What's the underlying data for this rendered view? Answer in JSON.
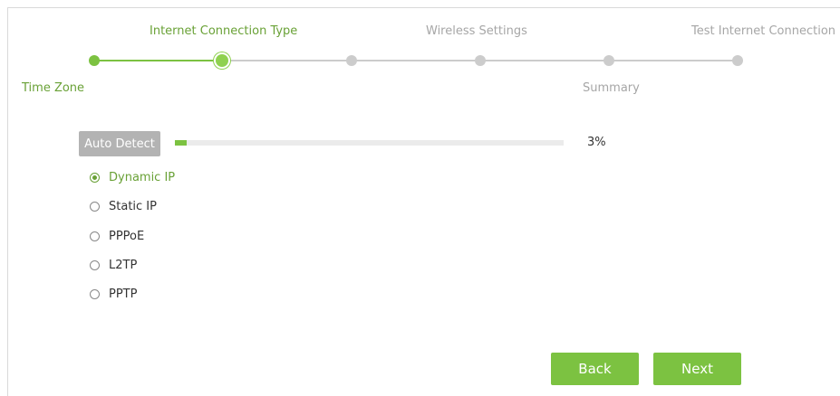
{
  "steps": {
    "internet_connection_type": "Internet Connection Type",
    "wireless_settings": "Wireless Settings",
    "test_internet_connection": "Test Internet Connection",
    "time_zone": "Time Zone",
    "summary": "Summary"
  },
  "auto_detect": {
    "button_label": "Auto Detect",
    "progress_percent": 3,
    "progress_text": "3%"
  },
  "connection_types": [
    {
      "label": "Dynamic IP",
      "selected": true
    },
    {
      "label": "Static IP",
      "selected": false
    },
    {
      "label": "PPPoE",
      "selected": false
    },
    {
      "label": "L2TP",
      "selected": false
    },
    {
      "label": "PPTP",
      "selected": false
    }
  ],
  "buttons": {
    "back": "Back",
    "next": "Next"
  },
  "colors": {
    "accent": "#7cc241",
    "accent_text": "#69a136",
    "inactive": "#cccccc"
  }
}
